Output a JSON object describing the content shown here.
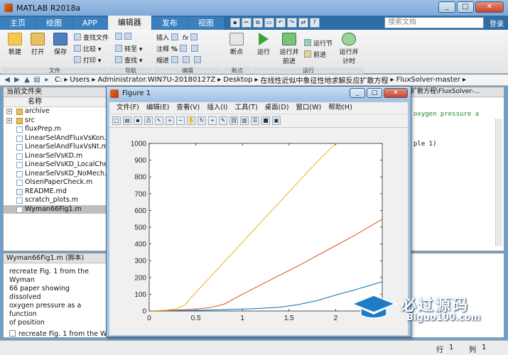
{
  "window": {
    "title": "MATLAB R2018a"
  },
  "tabs": [
    "主页",
    "绘图",
    "APP",
    "编辑器",
    "发布",
    "视图"
  ],
  "active_tab_index": 3,
  "search": {
    "placeholder": "搜索文档"
  },
  "login_label": "登录",
  "ribbon": {
    "new": "新建",
    "open": "打开",
    "save": "保存",
    "find_files": "查找文件",
    "compare": "比较",
    "print": "打印",
    "goto": "转至",
    "find": "查找",
    "insert": "插入",
    "comment": "注释",
    "indent": "缩进",
    "breakpoints": "断点",
    "run": "运行",
    "run_advance": [
      "运行并",
      "前进"
    ],
    "run_section": "运行节",
    "advance": "前进",
    "run_time": [
      "运行并",
      "计时"
    ],
    "groups": {
      "file": "文件",
      "navigate": "导航",
      "edit": "编辑",
      "breakpoints": "断点",
      "run": "运行"
    }
  },
  "path": {
    "segments": [
      "C:",
      "Users",
      "Administrator.WIN7U-20180127Z",
      "Desktop",
      "在线性近似中象征性地求解反应扩散方程",
      "FluxSolver-master"
    ]
  },
  "file_panel": {
    "title": "当前文件夹",
    "column": "名称",
    "items": [
      {
        "name": "archive",
        "type": "folder"
      },
      {
        "name": "src",
        "type": "folder"
      },
      {
        "name": "fluxPrep.m",
        "type": "m"
      },
      {
        "name": "LinearSelAndFluxVsKon.m",
        "type": "m"
      },
      {
        "name": "LinearSelAndFluxVsNt.m",
        "type": "m"
      },
      {
        "name": "LinearSelVsKD.m",
        "type": "m"
      },
      {
        "name": "LinearSelVsKD_LocalChem",
        "type": "m"
      },
      {
        "name": "LinearSelVsKD_NoMech.m",
        "type": "m"
      },
      {
        "name": "OlsenPaperCheck.m",
        "type": "m"
      },
      {
        "name": "README.md",
        "type": "md"
      },
      {
        "name": "scratch_plots.m",
        "type": "m"
      },
      {
        "name": "Wyman66Fig1.m",
        "type": "m",
        "selected": true
      }
    ]
  },
  "detail_panel": {
    "title": "Wyman66Fig1.m  (脚本)",
    "description": [
      "recreate Fig. 1 from the Wyman",
      "66 paper showing dissolved",
      "oxygen pressure as a function",
      "of position"
    ],
    "function_entry": "recreate Fig. 1 from the Wy"
  },
  "editor": {
    "header": "扩散方程\\FluxSolver-...",
    "code_lines": [
      "oxygen pressure a",
      "ple 1)"
    ]
  },
  "status": {
    "row_label": "行",
    "row_value": "1",
    "col_label": "列",
    "col_value": "1"
  },
  "figure": {
    "title": "Figure 1",
    "menu": [
      "文件(F)",
      "编辑(E)",
      "查看(V)",
      "插入(I)",
      "工具(T)",
      "桌面(D)",
      "窗口(W)",
      "帮助(H)"
    ]
  },
  "chart_data": {
    "type": "line",
    "xlim": [
      0,
      2.5
    ],
    "ylim": [
      0,
      1000
    ],
    "xticks": [
      0,
      0.5,
      1,
      1.5,
      2
    ],
    "xtick_labels": [
      "0",
      "0.5",
      "1",
      "1.5",
      "2"
    ],
    "yticks": [
      0,
      100,
      200,
      300,
      400,
      500,
      600,
      700,
      800,
      900,
      1000
    ],
    "ytick_labels": [
      "0",
      "100",
      "200",
      "300",
      "400",
      "500",
      "600",
      "700",
      "800",
      "900",
      "1000"
    ],
    "grid": false,
    "series": [
      {
        "color": "#0072BD",
        "x": [
          0,
          0.2,
          0.5,
          0.8,
          1.1,
          1.4,
          1.6,
          1.8,
          2.0,
          2.2,
          2.5
        ],
        "y": [
          0,
          2,
          4,
          8,
          13,
          22,
          38,
          62,
          95,
          125,
          175
        ]
      },
      {
        "color": "#D95319",
        "x": [
          0,
          0.3,
          0.5,
          0.65,
          0.8,
          1.0,
          1.3,
          1.6,
          1.9,
          2.2,
          2.5
        ],
        "y": [
          0,
          6,
          12,
          20,
          40,
          100,
          185,
          270,
          360,
          450,
          548
        ]
      },
      {
        "color": "#EDB120",
        "x": [
          0,
          0.2,
          0.3,
          0.38,
          0.45,
          0.6,
          0.8,
          1.0,
          1.2,
          1.4,
          1.6,
          1.8,
          2.0
        ],
        "y": [
          0,
          6,
          15,
          35,
          80,
          170,
          290,
          410,
          530,
          650,
          770,
          890,
          1000
        ]
      }
    ]
  }
}
